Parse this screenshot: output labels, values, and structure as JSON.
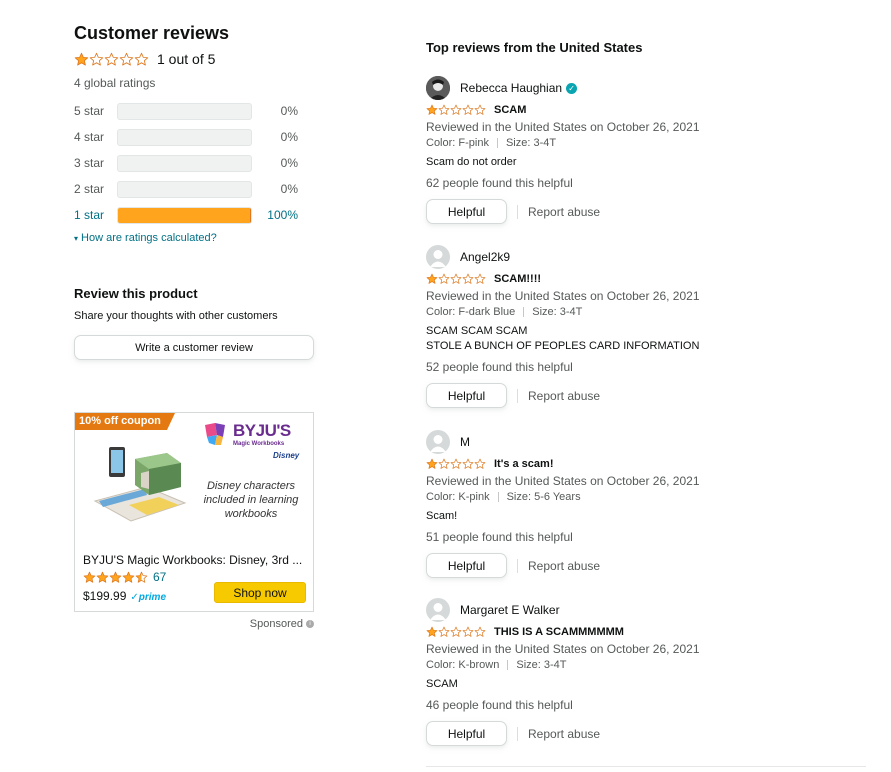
{
  "summary": {
    "title": "Customer reviews",
    "overall_rating": 1,
    "overall_text": "1 out of 5",
    "global_ratings": "4 global ratings",
    "histogram": [
      {
        "label": "5 star",
        "percent": 0,
        "percent_text": "0%"
      },
      {
        "label": "4 star",
        "percent": 0,
        "percent_text": "0%"
      },
      {
        "label": "3 star",
        "percent": 0,
        "percent_text": "0%"
      },
      {
        "label": "2 star",
        "percent": 0,
        "percent_text": "0%"
      },
      {
        "label": "1 star",
        "percent": 100,
        "percent_text": "100%"
      }
    ],
    "how_calculated": "How are ratings calculated?"
  },
  "review_product": {
    "title": "Review this product",
    "subtitle": "Share your thoughts with other customers",
    "button": "Write a customer review"
  },
  "ad": {
    "coupon": "10% off coupon",
    "logo_text": "BYJU'S",
    "logo_sub": "Magic Workbooks",
    "logo_brand": "Disney",
    "blurb": "Disney characters included in learning workbooks",
    "product_name": "BYJU'S Magic Workbooks: Disney, 3rd ...",
    "rating": 4.5,
    "rating_count": "67",
    "price": "$199.99",
    "prime": "prime",
    "shop_button": "Shop now",
    "sponsored": "Sponsored"
  },
  "top_reviews": {
    "title": "Top reviews from the United States",
    "reviews": [
      {
        "name": "Rebecca Haughian",
        "verified": true,
        "rating": 1,
        "title": "SCAM",
        "meta": "Reviewed in the United States on October 26, 2021",
        "color": "Color: F-pink",
        "size": "Size: 3-4T",
        "body_lines": [
          "Scam do not order"
        ],
        "helpful_text": "62 people found this helpful",
        "helpful_button": "Helpful",
        "report": "Report abuse"
      },
      {
        "name": "Angel2k9",
        "verified": false,
        "rating": 1,
        "title": "SCAM!!!!",
        "meta": "Reviewed in the United States on October 26, 2021",
        "color": "Color: F-dark Blue",
        "size": "Size: 3-4T",
        "body_lines": [
          "SCAM SCAM SCAM",
          "STOLE A BUNCH OF PEOPLES CARD INFORMATION"
        ],
        "helpful_text": "52 people found this helpful",
        "helpful_button": "Helpful",
        "report": "Report abuse"
      },
      {
        "name": "M",
        "verified": false,
        "rating": 1,
        "title": "It's a scam!",
        "meta": "Reviewed in the United States on October 26, 2021",
        "color": "Color: K-pink",
        "size": "Size: 5-6 Years",
        "body_lines": [
          "Scam!"
        ],
        "helpful_text": "51 people found this helpful",
        "helpful_button": "Helpful",
        "report": "Report abuse"
      },
      {
        "name": "Margaret E Walker",
        "verified": false,
        "rating": 1,
        "title": "THIS IS A SCAMMMMMM",
        "meta": "Reviewed in the United States on October 26, 2021",
        "color": "Color: K-brown",
        "size": "Size: 3-4T",
        "body_lines": [
          "SCAM"
        ],
        "helpful_text": "46 people found this helpful",
        "helpful_button": "Helpful",
        "report": "Report abuse"
      }
    ]
  },
  "colors": {
    "star": "#FFA41C",
    "star_outline": "#DE7921",
    "link": "#007185",
    "muted": "#565959",
    "shop_button": "#F7CA00",
    "coupon": "#E47911"
  }
}
